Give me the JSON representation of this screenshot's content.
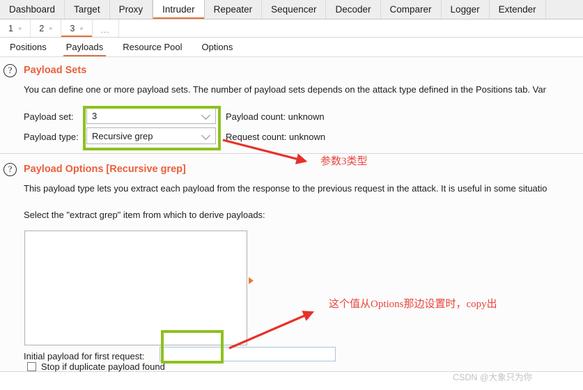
{
  "window": {
    "app": "Burp Suite - Intruder",
    "bg": "#ffffff"
  },
  "main_tabs": [
    {
      "label": "Dashboard",
      "active": false
    },
    {
      "label": "Target",
      "active": false
    },
    {
      "label": "Proxy",
      "active": false
    },
    {
      "label": "Intruder",
      "active": true
    },
    {
      "label": "Repeater",
      "active": false
    },
    {
      "label": "Sequencer",
      "active": false
    },
    {
      "label": "Decoder",
      "active": false
    },
    {
      "label": "Comparer",
      "active": false
    },
    {
      "label": "Logger",
      "active": false
    },
    {
      "label": "Extender",
      "active": false
    }
  ],
  "attack_tabs": [
    {
      "label": "1",
      "close": "×",
      "active": false
    },
    {
      "label": "2",
      "close": "×",
      "active": false
    },
    {
      "label": "3",
      "close": "×",
      "active": true
    }
  ],
  "attack_tabs_overflow": "...",
  "sub_tabs": [
    {
      "label": "Positions",
      "active": false
    },
    {
      "label": "Payloads",
      "active": true
    },
    {
      "label": "Resource Pool",
      "active": false
    },
    {
      "label": "Options",
      "active": false
    }
  ],
  "payload_sets": {
    "help_icon": "question-mark-icon",
    "title": "Payload Sets",
    "description": "You can define one or more payload sets. The number of payload sets depends on the attack type defined in the Positions tab. Var",
    "payload_set_label": "Payload set:",
    "payload_set_value": "3",
    "payload_type_label": "Payload type:",
    "payload_type_value": "Recursive grep",
    "payload_count": "Payload count:  unknown",
    "request_count": "Request count:  unknown"
  },
  "payload_options": {
    "help_icon": "question-mark-icon",
    "title": "Payload Options [Recursive grep]",
    "description": "This payload type lets you extract each payload from the response to the previous request in the attack. It is useful in some situatio",
    "select_label": "Select the \"extract grep\" item from which to derive payloads:",
    "listbox_items": [],
    "initial_payload_label": "Initial payload for first request:",
    "initial_payload_value": "",
    "stop_duplicate_label": "Stop if duplicate payload found",
    "stop_duplicate_checked": false,
    "marker_icon": "triangle-right-icon"
  },
  "annotations": {
    "green_color": "#8dc11f",
    "red_color": "#e8443c",
    "note_1": "参数3类型",
    "note_2": "这个值从Options那边设置时，copy出"
  },
  "watermark": {
    "text": "CSDN @大象只为你"
  }
}
